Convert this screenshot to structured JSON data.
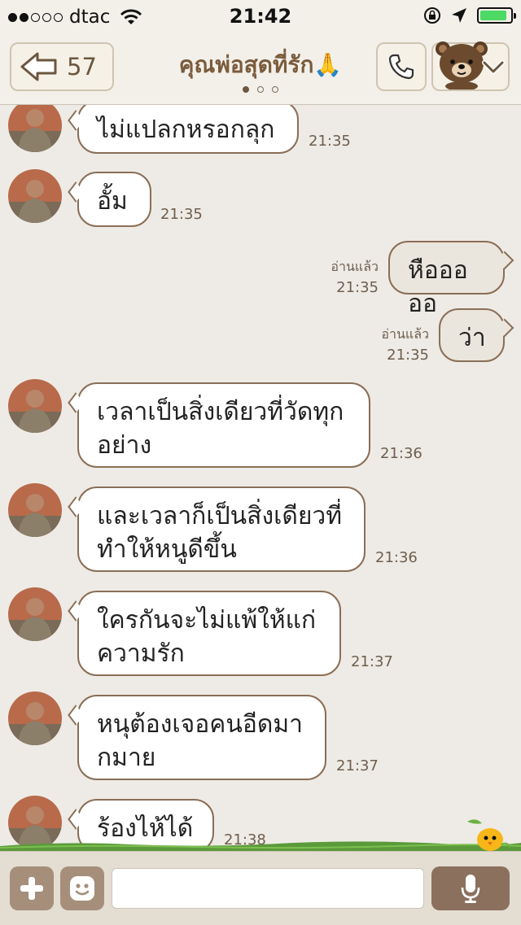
{
  "status_bar": {
    "carrier": "dtac",
    "signal_dots_filled": 2,
    "signal_dots_total": 5,
    "time": "21:42",
    "battery_level_fraction": 0.9,
    "battery_color": "#4cd964"
  },
  "header": {
    "back_count": "57",
    "title": "คุณพ่อสุดที่รัก🙏",
    "page_dots_total": 3,
    "page_dots_active": 1
  },
  "messages": [
    {
      "side": "in",
      "text": "ไม่แปลกหรอกลุก",
      "time": "21:35"
    },
    {
      "side": "in",
      "text": "อั้ม",
      "time": "21:35"
    },
    {
      "side": "out",
      "text": "หือออออ",
      "read": "อ่านแล้ว",
      "time": "21:35"
    },
    {
      "side": "out",
      "text": "ว่า",
      "read": "อ่านแล้ว",
      "time": "21:35"
    },
    {
      "side": "in",
      "text": "เวลาเป็นสิ่งเดียวที่วัดทุก\nอย่าง",
      "time": "21:36"
    },
    {
      "side": "in",
      "text": "และเวลาก็เป็นสิ่งเดียวที่\nทำให้หนูดีขึ้น",
      "time": "21:36"
    },
    {
      "side": "in",
      "text": "ใครกันจะไม่แพ้ให้แก่\nความรัก",
      "time": "21:37"
    },
    {
      "side": "in",
      "text": "หนุต้องเจอคนอีดมา\nกมาย",
      "time": "21:37"
    },
    {
      "side": "in",
      "text": "ร้องไห้ได้",
      "time": "21:38"
    }
  ],
  "input_bar": {
    "message_value": ""
  },
  "colors": {
    "accent_brown": "#7a5c3c",
    "bubble_border": "#8a6e56",
    "chat_background": "#eeebe6"
  }
}
